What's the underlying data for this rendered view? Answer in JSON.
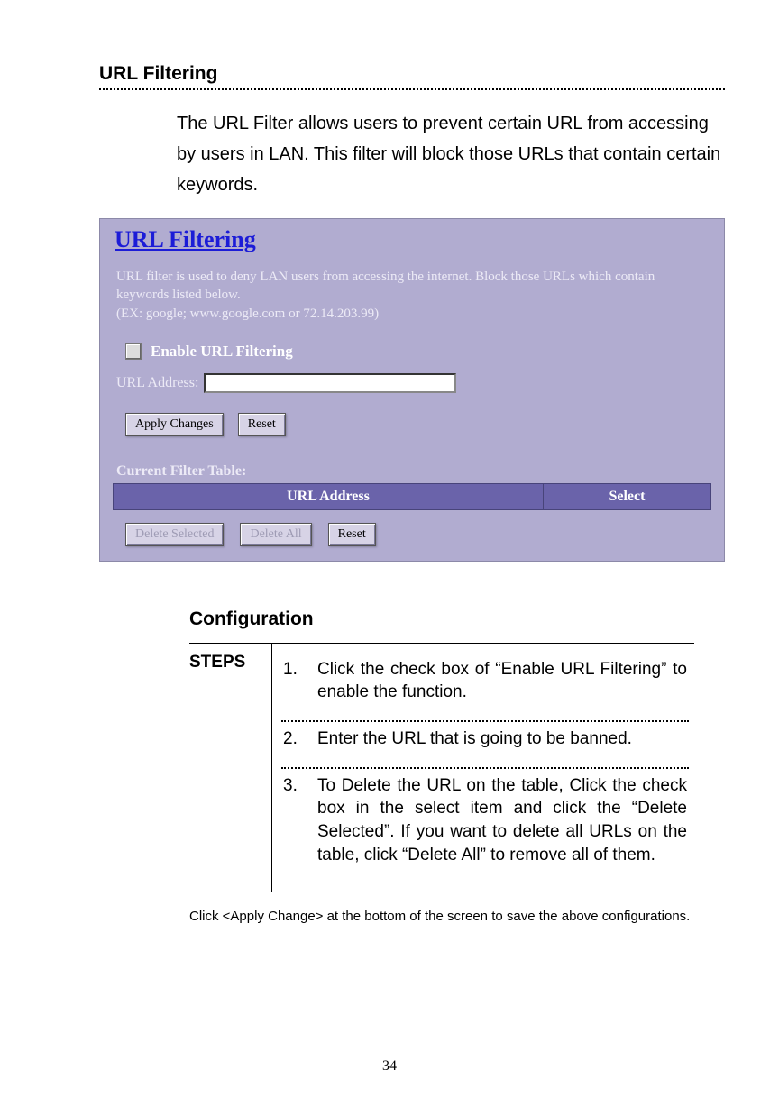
{
  "section": {
    "title": "URL Filtering",
    "intro": "The URL Filter allows users to prevent certain URL from accessing by users in LAN. This filter will block those URLs that contain certain keywords."
  },
  "ui": {
    "title": "URL Filtering",
    "help": "URL filter is used to deny LAN users from accessing the internet. Block those URLs which contain keywords listed below.\n(EX: google; www.google.com or 72.14.203.99)",
    "enable_label": "Enable URL Filtering",
    "url_address_label": "URL Address:",
    "url_address_value": "",
    "buttons": {
      "apply": "Apply Changes",
      "reset": "Reset",
      "delete_selected": "Delete Selected",
      "delete_all": "Delete All",
      "reset2": "Reset"
    },
    "table": {
      "caption": "Current Filter Table:",
      "headers": {
        "url": "URL Address",
        "select": "Select"
      }
    }
  },
  "configuration": {
    "heading": "Configuration",
    "steps_label": "STEPS",
    "steps": [
      {
        "n": "1.",
        "text": "Click the check box of “Enable URL Filtering” to enable the function."
      },
      {
        "n": "2.",
        "text": "Enter the URL that is going to be banned."
      },
      {
        "n": "3.",
        "text": "To Delete the URL on the table, Click the check box in the select item and click the “Delete Selected”. If you want to delete all URLs on the table, click “Delete All” to remove all of them."
      }
    ],
    "footnote": "Click <Apply Change> at the bottom of the screen to save the above configurations."
  },
  "page_number": "34"
}
